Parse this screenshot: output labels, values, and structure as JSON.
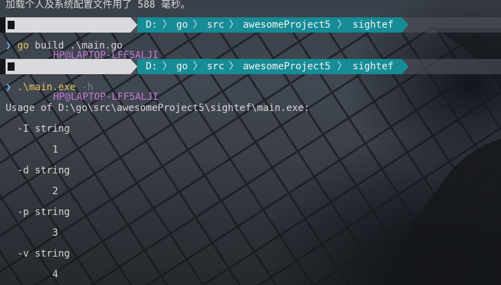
{
  "terminal": {
    "profile_message": "加载个人及系统配置文件用了 588 毫秒。",
    "prompts": [
      {
        "host": "HP@LAPTOP-LFF5ALJI",
        "path": [
          "D:",
          "go",
          "src",
          "awesomeProject5",
          "sightef"
        ],
        "prompt_char": "❯",
        "command": "go",
        "args": " build .\\main.go",
        "flag": ""
      },
      {
        "host": "HP@LAPTOP-LFF5ALJI",
        "path": [
          "D:",
          "go",
          "src",
          "awesomeProject5",
          "sightef"
        ],
        "prompt_char": "❯",
        "command": ".\\main.exe",
        "args": " ",
        "flag": "-h"
      }
    ],
    "output": [
      "Usage of D:\\go\\src\\awesomeProject5\\sightef\\main.exe:",
      "  -I string",
      "        1",
      "  -d string",
      "        2",
      "  -p string",
      "        3",
      "  -v string",
      "        4"
    ]
  },
  "colors": {
    "host_bg": "#d9d9de",
    "host_text": "#c77ad6",
    "path_bg": "#168c96",
    "command": "#e6c65a",
    "prompt_char": "#6fb8e8"
  }
}
